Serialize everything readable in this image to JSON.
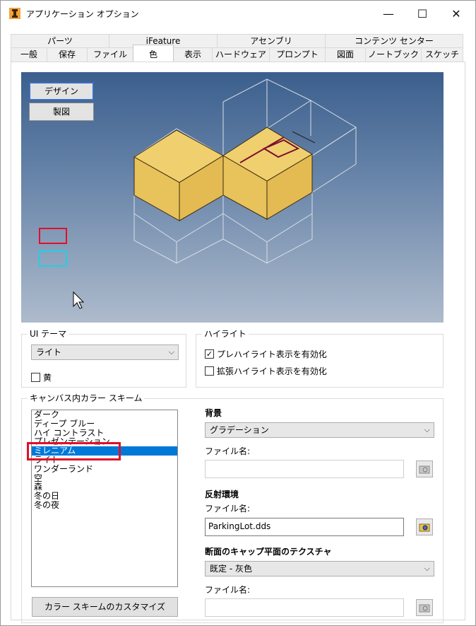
{
  "window": {
    "title": "アプリケーション オプション",
    "minimize": "—",
    "maximize": "☐",
    "close": "✕"
  },
  "tabs": {
    "row1": [
      "パーツ",
      "iFeature",
      "アセンブリ",
      "コンテンツ センター"
    ],
    "row2": [
      "一般",
      "保存",
      "ファイル",
      "色",
      "表示",
      "ハードウェア",
      "プロンプト",
      "図面",
      "ノートブック",
      "スケッチ"
    ],
    "active": "色"
  },
  "preview": {
    "design_button": "デザイン",
    "drawing_button": "製図"
  },
  "ui_theme": {
    "title": "UI テーマ",
    "selected": "ライト",
    "amber_label": "黄",
    "amber_checked": false
  },
  "highlight": {
    "title": "ハイライト",
    "prehighlight_label": "プレハイライト表示を有効化",
    "prehighlight_checked": true,
    "enhanced_label": "拡張ハイライト表示を有効化",
    "enhanced_checked": false
  },
  "color_scheme": {
    "title": "キャンバス内カラー スキーム",
    "items": [
      "ダーク",
      "ディープ ブルー",
      "ハイ コントラスト",
      "プレゼンテーション",
      "ミレニアム",
      "ライト",
      "ワンダーランド",
      "空",
      "森",
      "冬の日",
      "冬の夜"
    ],
    "selected": "ミレニアム",
    "customize_button": "カラー スキームのカスタマイズ"
  },
  "background": {
    "label": "背景",
    "selected": "グラデーション",
    "file_label": "ファイル名:",
    "file_value": ""
  },
  "reflection": {
    "label": "反射環境",
    "file_label": "ファイル名:",
    "file_value": "ParkingLot.dds"
  },
  "section_cap": {
    "label": "断面のキャップ平面のテクスチャ",
    "selected": "既定 - 灰色",
    "file_label": "ファイル名:",
    "file_value": ""
  },
  "colors": {
    "selection_blue": "#0078d7",
    "highlight_red": "#e0102a",
    "cube_face": "#e8c25a"
  }
}
